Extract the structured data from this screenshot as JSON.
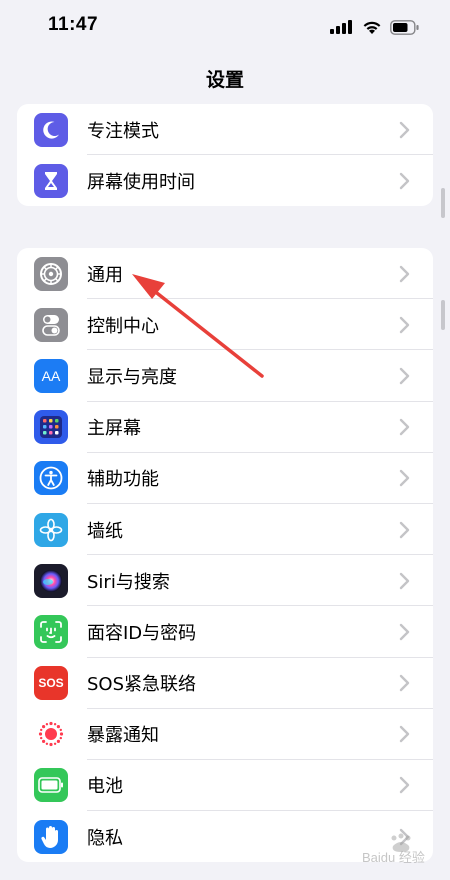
{
  "status": {
    "time": "11:47"
  },
  "nav": {
    "title": "设置"
  },
  "groups": [
    {
      "items": [
        {
          "label": "专注模式",
          "icon": "moon-icon",
          "color": "#5e5ce6"
        },
        {
          "label": "屏幕使用时间",
          "icon": "hourglass-icon",
          "color": "#5e5ce6"
        }
      ]
    },
    {
      "items": [
        {
          "label": "通用",
          "icon": "gear-icon",
          "color": "#8e8e93"
        },
        {
          "label": "控制中心",
          "icon": "toggles-icon",
          "color": "#8e8e93"
        },
        {
          "label": "显示与亮度",
          "icon": "text-size-icon",
          "color": "#1c7cf4"
        },
        {
          "label": "主屏幕",
          "icon": "home-screen-grid-icon",
          "color": "#2f5bea"
        },
        {
          "label": "辅助功能",
          "icon": "accessibility-icon",
          "color": "#1a7cf4"
        },
        {
          "label": "墙纸",
          "icon": "flower-icon",
          "color": "#2fa7e6"
        },
        {
          "label": "Siri与搜索",
          "icon": "siri-icon",
          "color": "#1b1b2b"
        },
        {
          "label": "面容ID与密码",
          "icon": "face-id-icon",
          "color": "#34c759"
        },
        {
          "label": "SOS紧急联络",
          "icon": "sos-icon",
          "color": "#e8352a"
        },
        {
          "label": "暴露通知",
          "icon": "exposure-icon",
          "color": "#ffffff"
        },
        {
          "label": "电池",
          "icon": "battery-icon",
          "color": "#34c759"
        },
        {
          "label": "隐私",
          "icon": "hand-icon",
          "color": "#1a7cf4"
        }
      ]
    }
  ],
  "annotation": {
    "arrow_color": "#e8403a"
  },
  "icons": {
    "sos_text": "SOS",
    "aa_text": "AA"
  }
}
